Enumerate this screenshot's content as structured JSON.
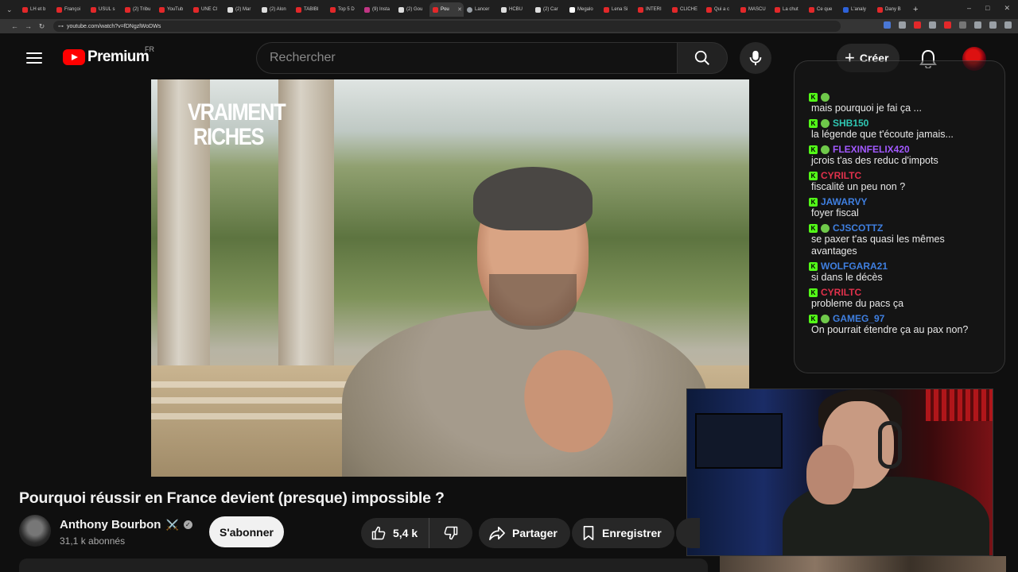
{
  "browser": {
    "tabs": [
      {
        "label": "LH et b",
        "icon": "youtube"
      },
      {
        "label": "Françoi",
        "icon": "youtube"
      },
      {
        "label": "USUL s",
        "icon": "youtube"
      },
      {
        "label": "(2) Tribu",
        "icon": "youtube"
      },
      {
        "label": "YouTub",
        "icon": "youtube"
      },
      {
        "label": "UNE Cl",
        "icon": "youtube"
      },
      {
        "label": "(2) Mar",
        "icon": "x"
      },
      {
        "label": "(2) Alon",
        "icon": "x"
      },
      {
        "label": "TABIBI",
        "icon": "youtube"
      },
      {
        "label": "Top 5 D",
        "icon": "youtube"
      },
      {
        "label": "(9) Insta",
        "icon": "instagram"
      },
      {
        "label": "(2) Gou",
        "icon": "x"
      },
      {
        "label": "Pou",
        "icon": "youtube",
        "active": true
      },
      {
        "label": "Lancer",
        "icon": "generic"
      },
      {
        "label": "HCBU",
        "icon": "x"
      },
      {
        "label": "(2) Car",
        "icon": "x"
      },
      {
        "label": "Megalo",
        "icon": "tiktok"
      },
      {
        "label": "Lena Si",
        "icon": "youtube"
      },
      {
        "label": "INTERI",
        "icon": "youtube"
      },
      {
        "label": "CLICHE",
        "icon": "youtube"
      },
      {
        "label": "Qui a c",
        "icon": "youtube"
      },
      {
        "label": "MASCU",
        "icon": "youtube"
      },
      {
        "label": "La chut",
        "icon": "youtube"
      },
      {
        "label": "Ce que",
        "icon": "youtube"
      },
      {
        "label": "L'analy",
        "icon": "news"
      },
      {
        "label": "Dany B",
        "icon": "youtube"
      }
    ],
    "url": "youtube.com/watch?v=fDNgzlWoDWs",
    "extension_colors": [
      "#4a78d6",
      "#9aa0a6",
      "#e3282a",
      "#9aa0a6",
      "#e3282a",
      "#777777",
      "#9aa0a6",
      "#9aa0a6",
      "#9aa0a6"
    ]
  },
  "header": {
    "logo_text": "Premium",
    "country_code": "FR",
    "search_placeholder": "Rechercher",
    "create_label": "Créer"
  },
  "video": {
    "overlay_title": "VRAIMENT RICHES"
  },
  "chat": {
    "messages": [
      {
        "user": "",
        "text": "mais pourquoi je fai ça ...",
        "color": "#d1a84a",
        "badges": 2
      },
      {
        "user": "SHB150",
        "text": "la légende que t'écoute jamais...",
        "color": "#2fc7b3",
        "badges": 2
      },
      {
        "user": "FLEXINFELIX420",
        "text": "jcrois t'as des reduc d'impots",
        "color": "#a259ff",
        "badges": 2
      },
      {
        "user": "CYRILTC",
        "text": "fiscalité un peu non ?",
        "color": "#e0314b",
        "badges": 1
      },
      {
        "user": "JAWARVY",
        "text": "foyer fiscal",
        "color": "#3f7fe0",
        "badges": 1
      },
      {
        "user": "CJSCOTTZ",
        "text": "se paxer t'as quasi les mêmes avantages",
        "color": "#3f7fe0",
        "badges": 2
      },
      {
        "user": "WOLFGARA21",
        "text": "si dans le décès",
        "color": "#3f7fe0",
        "badges": 1
      },
      {
        "user": "CYRILTC",
        "text": "probleme du pacs ça",
        "color": "#e0314b",
        "badges": 1
      },
      {
        "user": "GAMEG_97",
        "text": "On pourrait étendre ça au pax non?",
        "color": "#3f7fe0",
        "badges": 2
      }
    ]
  },
  "meta": {
    "title": "Pourquoi réussir en France devient (presque) impossible ?",
    "channel_name": "Anthony Bourbon",
    "channel_emoji": "⚔️",
    "subscribers": "31,1 k abonnés",
    "subscribe_label": "S'abonner",
    "likes": "5,4 k",
    "share_label": "Partager",
    "save_label": "Enregistrer"
  }
}
